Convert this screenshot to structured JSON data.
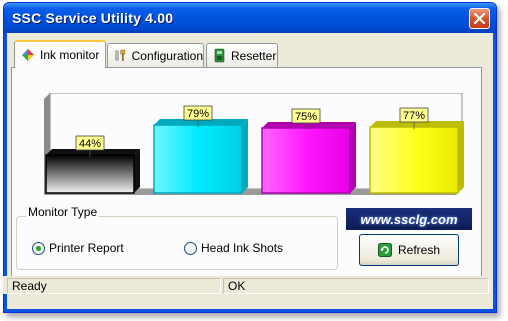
{
  "window": {
    "title": "SSC Service Utility 4.00"
  },
  "tabs": [
    {
      "label": "Ink monitor",
      "icon": "ink-drop-icon",
      "active": true
    },
    {
      "label": "Configuration",
      "icon": "tools-icon",
      "active": false
    },
    {
      "label": "Resetter",
      "icon": "chip-icon",
      "active": false
    }
  ],
  "ink_levels": [
    {
      "label": "44%",
      "value": 44,
      "color": "#000000"
    },
    {
      "label": "79%",
      "value": 79,
      "color": "#00e5ff"
    },
    {
      "label": "75%",
      "value": 75,
      "color": "#ff00ff"
    },
    {
      "label": "77%",
      "value": 77,
      "color": "#ffff00"
    }
  ],
  "monitor_type": {
    "label": "Monitor Type",
    "options": [
      {
        "label": "Printer Report",
        "selected": true
      },
      {
        "label": "Head Ink Shots",
        "selected": false
      }
    ]
  },
  "banner": {
    "text": "www.ssclg.com"
  },
  "refresh_button": {
    "label": "Refresh",
    "icon": "refresh-icon"
  },
  "statusbar": {
    "left": "Ready",
    "right": "OK"
  }
}
